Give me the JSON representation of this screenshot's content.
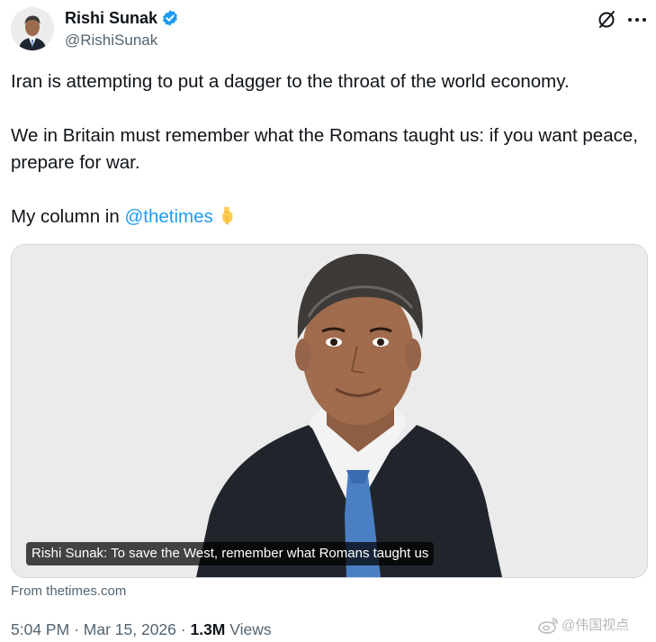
{
  "author": {
    "display_name": "Rishi Sunak",
    "handle": "@RishiSunak",
    "avatar_icon": "profile-photo",
    "verified_icon": "verified-badge-icon"
  },
  "header_icons": [
    "grok-icon",
    "more-icon"
  ],
  "tweet": {
    "line1": "Iran is attempting to put a dagger to the throat of the world economy.",
    "paragraph2": "We in Britain must remember what the Romans taught us: if you want peace, prepare for war.",
    "paragraph3_prefix": "My column in ",
    "mention": "@thetimes",
    "emoji_icon": "backhand-index-pointing-down-icon"
  },
  "card": {
    "title": "Rishi Sunak: To save the West, remember what Romans taught us",
    "source": "From thetimes.com"
  },
  "meta": {
    "time": "5:04 PM",
    "separator": "·",
    "date": "Mar 15, 2026",
    "views_count": "1.3M",
    "views_label": "Views"
  },
  "watermark": {
    "text": "@伟国视点",
    "icon": "weibo-logo-icon"
  },
  "colors": {
    "text": "#0f1419",
    "secondary": "#536471",
    "link": "#1d9bf0",
    "border": "#cfd9de",
    "verified": "#1d9bf0"
  }
}
